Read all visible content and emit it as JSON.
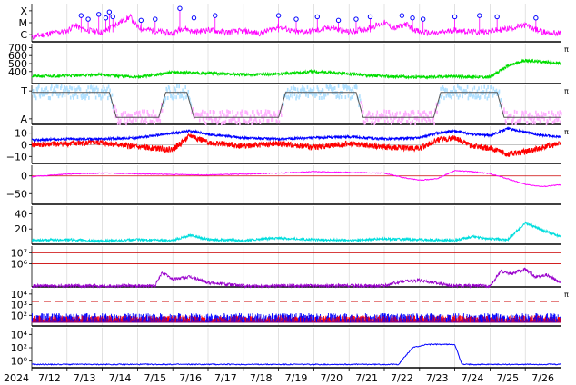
{
  "chart_data": {
    "type": "line",
    "colors": {
      "xray": "#ff00ff",
      "flare_marker": "#0000ff",
      "wind_speed": "#00dd00",
      "sector_shade": "#b0e0ff",
      "sector_shade_alt": "#ffb0ff",
      "sector_line": "#555555",
      "bt": "#0000ff",
      "bz": "#ff0000",
      "dst": "#ff00ff",
      "dst_zero": "#cc0000",
      "kp_like": "#00dddd",
      "proton": "#9900cc",
      "proton_threshold": "#cc0000",
      "electron_blue": "#0000ff",
      "electron_red": "#ff0000",
      "electron_threshold": "#cc0000",
      "cr": "#0000ff"
    },
    "x_axis": {
      "year_label": "2024",
      "day_labels": [
        "7/12",
        "7/13",
        "7/14",
        "7/15",
        "7/16",
        "7/17",
        "7/18",
        "7/19",
        "7/20",
        "7/21",
        "7/22",
        "7/23",
        "7/24",
        "7/25",
        "7/26"
      ]
    },
    "panels": [
      {
        "id": "xray",
        "tick_labels": [
          "X",
          "M",
          "C"
        ],
        "tick_values": [
          2,
          1,
          0
        ],
        "ylim": [
          -0.6,
          2.6
        ],
        "series": {
          "x": [
            0.0,
            0.5,
            1.0,
            1.2,
            1.5,
            2.0,
            2.4,
            2.8,
            3.0,
            3.5,
            4.0,
            4.3,
            4.6,
            5.0,
            5.5,
            6.0,
            6.5,
            7.0,
            7.5,
            8.0,
            8.5,
            9.0,
            9.5,
            10.0,
            10.3,
            10.6,
            11.0,
            11.5,
            12.0,
            12.5,
            13.0,
            13.5,
            14.0,
            14.5,
            15.0
          ],
          "y": [
            -0.2,
            0.1,
            0.3,
            0.8,
            0.4,
            0.2,
            0.9,
            1.5,
            0.6,
            0.3,
            0.1,
            0.6,
            0.2,
            0.4,
            0.2,
            0.3,
            0.1,
            0.7,
            0.2,
            0.3,
            0.6,
            0.2,
            0.5,
            1.0,
            0.5,
            0.9,
            0.2,
            0.1,
            0.4,
            0.2,
            0.3,
            0.5,
            0.8,
            0.2,
            0.1
          ]
        },
        "markers": [
          {
            "x": 1.4,
            "y": 1.6
          },
          {
            "x": 1.6,
            "y": 1.3
          },
          {
            "x": 1.9,
            "y": 1.7
          },
          {
            "x": 2.1,
            "y": 1.4
          },
          {
            "x": 2.2,
            "y": 1.9
          },
          {
            "x": 2.3,
            "y": 1.5
          },
          {
            "x": 3.1,
            "y": 1.2
          },
          {
            "x": 3.5,
            "y": 1.3
          },
          {
            "x": 4.2,
            "y": 2.2
          },
          {
            "x": 4.6,
            "y": 1.4
          },
          {
            "x": 5.2,
            "y": 1.6
          },
          {
            "x": 7.0,
            "y": 1.6
          },
          {
            "x": 7.5,
            "y": 1.3
          },
          {
            "x": 8.1,
            "y": 1.5
          },
          {
            "x": 8.7,
            "y": 1.2
          },
          {
            "x": 9.2,
            "y": 1.3
          },
          {
            "x": 9.6,
            "y": 1.5
          },
          {
            "x": 10.5,
            "y": 1.6
          },
          {
            "x": 10.8,
            "y": 1.4
          },
          {
            "x": 11.1,
            "y": 1.3
          },
          {
            "x": 12.0,
            "y": 1.5
          },
          {
            "x": 12.7,
            "y": 1.6
          },
          {
            "x": 13.2,
            "y": 1.5
          },
          {
            "x": 14.3,
            "y": 1.4
          }
        ]
      },
      {
        "id": "wind",
        "tick_labels": [
          "700",
          "600",
          "500",
          "400"
        ],
        "tick_values": [
          700,
          600,
          500,
          400
        ],
        "ylim": [
          250,
          750
        ],
        "right_label": "π",
        "series": {
          "x": [
            0,
            1,
            2,
            3,
            4,
            5,
            6,
            7,
            8,
            9,
            10,
            11,
            12,
            13,
            13.5,
            14,
            14.5,
            15
          ],
          "y": [
            340,
            350,
            360,
            330,
            390,
            380,
            360,
            370,
            400,
            370,
            340,
            330,
            340,
            330,
            470,
            540,
            520,
            500
          ]
        }
      },
      {
        "id": "sector",
        "tick_labels": [
          "T",
          "A"
        ],
        "tick_values": [
          1,
          -1
        ],
        "ylim": [
          -1.4,
          1.4
        ],
        "right_label": "π",
        "levels": {
          "x": [
            0,
            2.2,
            2.4,
            3.6,
            3.8,
            4.4,
            4.6,
            7.0,
            7.2,
            9.2,
            9.4,
            11.4,
            11.6,
            13.2,
            13.4,
            15
          ],
          "y": [
            0.9,
            0.9,
            -0.9,
            -0.9,
            0.9,
            0.9,
            -0.9,
            -0.9,
            0.9,
            0.9,
            -0.9,
            -0.9,
            0.9,
            0.9,
            -0.9,
            -0.9
          ]
        }
      },
      {
        "id": "imf",
        "tick_labels": [
          "10",
          "0",
          "−10"
        ],
        "tick_values": [
          10,
          0,
          -10
        ],
        "ylim": [
          -16,
          16
        ],
        "right_label": "π",
        "bt": {
          "x": [
            0,
            1,
            2,
            3,
            4,
            4.5,
            5,
            6,
            7,
            8,
            9,
            10,
            11,
            11.5,
            12,
            12.5,
            13,
            13.5,
            14,
            14.5,
            15
          ],
          "y": [
            4,
            5,
            5,
            6,
            10,
            12,
            9,
            6,
            5,
            6,
            7,
            5,
            6,
            10,
            12,
            9,
            8,
            14,
            11,
            8,
            7
          ]
        },
        "bz": {
          "x": [
            0,
            1,
            2,
            3,
            4,
            4.5,
            5,
            6,
            7,
            8,
            9,
            10,
            11,
            11.5,
            12,
            12.5,
            13,
            13.5,
            14,
            14.5,
            15
          ],
          "y": [
            0,
            1,
            2,
            -2,
            -4,
            8,
            2,
            -1,
            1,
            -2,
            1,
            -2,
            -3,
            4,
            6,
            -1,
            -3,
            -8,
            -6,
            -2,
            1
          ]
        }
      },
      {
        "id": "dst",
        "tick_labels": [
          "0",
          "−50"
        ],
        "tick_values": [
          0,
          -50
        ],
        "ylim": [
          -80,
          30
        ],
        "series": {
          "x": [
            0,
            1,
            2,
            3,
            4,
            5,
            6,
            7,
            8,
            9,
            10,
            10.5,
            11,
            11.5,
            12,
            12.5,
            13,
            13.5,
            14,
            14.5,
            15
          ],
          "y": [
            -2,
            5,
            8,
            6,
            4,
            3,
            5,
            8,
            12,
            10,
            8,
            -4,
            -12,
            -8,
            15,
            12,
            6,
            -8,
            -24,
            -30,
            -25
          ]
        }
      },
      {
        "id": "kp",
        "tick_labels": [
          "40",
          "20"
        ],
        "tick_values": [
          40,
          20
        ],
        "ylim": [
          0,
          50
        ],
        "series": {
          "x": [
            0,
            1,
            2,
            3,
            4,
            4.5,
            5,
            6,
            7,
            8,
            9,
            10,
            11,
            12,
            12.5,
            13,
            13.5,
            14,
            14.5,
            15
          ],
          "y": [
            5,
            6,
            4,
            6,
            5,
            12,
            6,
            5,
            8,
            6,
            5,
            7,
            6,
            5,
            10,
            7,
            6,
            28,
            18,
            10
          ]
        }
      },
      {
        "id": "proton",
        "tick_labels": [
          "10⁷",
          "10⁶"
        ],
        "tick_values": [
          7,
          6
        ],
        "ylim": [
          3.9,
          7.6
        ],
        "thresholds": [
          7,
          6
        ],
        "series": {
          "x": [
            0,
            1,
            2,
            3,
            3.5,
            3.7,
            4,
            4.5,
            5,
            6,
            7,
            8,
            9,
            10,
            10.5,
            11,
            12,
            13,
            13.3,
            13.6,
            14,
            14.3,
            14.6,
            15
          ],
          "y": [
            4,
            4,
            4,
            4,
            4,
            5.2,
            4.6,
            4.8,
            4.3,
            4,
            4,
            4,
            4,
            4,
            4.4,
            4.5,
            4,
            4,
            5.3,
            5.1,
            5.5,
            4.8,
            5.0,
            4.3
          ]
        }
      },
      {
        "id": "electron",
        "tick_labels": [
          "10⁴",
          "10³",
          "10²"
        ],
        "tick_values": [
          4,
          3,
          2
        ],
        "ylim": [
          1,
          4.5
        ],
        "right_label": "π",
        "threshold": 3.3
      },
      {
        "id": "cr",
        "tick_labels": [
          "10⁴",
          "10²",
          "10⁰"
        ],
        "tick_values": [
          4,
          2,
          0
        ],
        "ylim": [
          -1,
          5
        ],
        "series": {
          "x": [
            0,
            10.4,
            10.8,
            11.2,
            11.6,
            12.0,
            12.2,
            12.6,
            15
          ],
          "y": [
            -0.5,
            -0.5,
            2,
            2.5,
            2.5,
            2.5,
            -0.5,
            -0.5,
            -0.5
          ]
        }
      }
    ]
  }
}
